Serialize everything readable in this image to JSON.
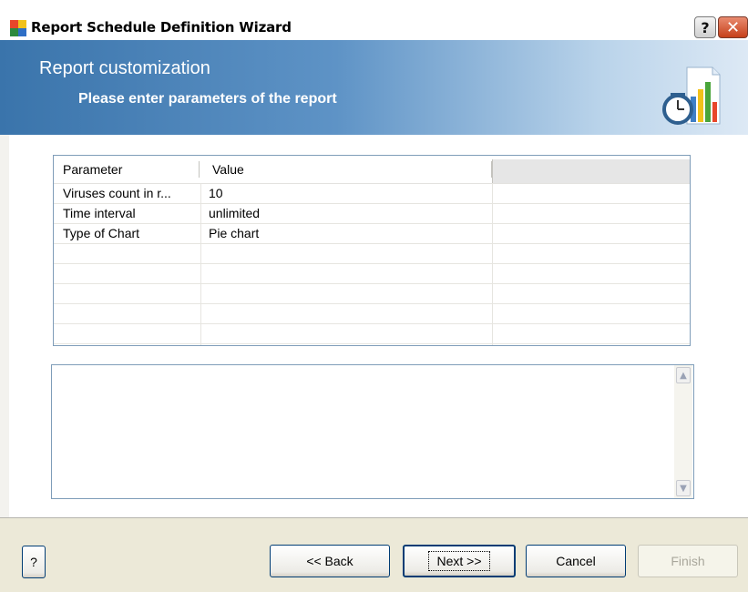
{
  "window": {
    "title": "Report Schedule Definition Wizard",
    "help_glyph": "?",
    "close_glyph": "✕"
  },
  "header": {
    "title": "Report customization",
    "subtitle": "Please enter parameters of the report"
  },
  "grid": {
    "columns": [
      "Parameter",
      "Value"
    ],
    "rows": [
      {
        "parameter": "Viruses count in r...",
        "value": "10"
      },
      {
        "parameter": "Time interval",
        "value": "unlimited"
      },
      {
        "parameter": "Type of Chart",
        "value": "Pie chart"
      }
    ]
  },
  "description": {
    "text": "",
    "scroll_up_glyph": "▲",
    "scroll_down_glyph": "▼"
  },
  "footer": {
    "help_label": "?",
    "back_label": "<< Back",
    "next_label": "Next >>",
    "cancel_label": "Cancel",
    "finish_label": "Finish"
  },
  "colors": {
    "header_gradient_start": "#3a74ab",
    "header_gradient_end": "#dde9f5",
    "dialog_background": "#ece9d8",
    "button_border": "#003c74"
  },
  "icons": {
    "app": "avg-app-icon",
    "report": "report-chart-clock-icon"
  }
}
